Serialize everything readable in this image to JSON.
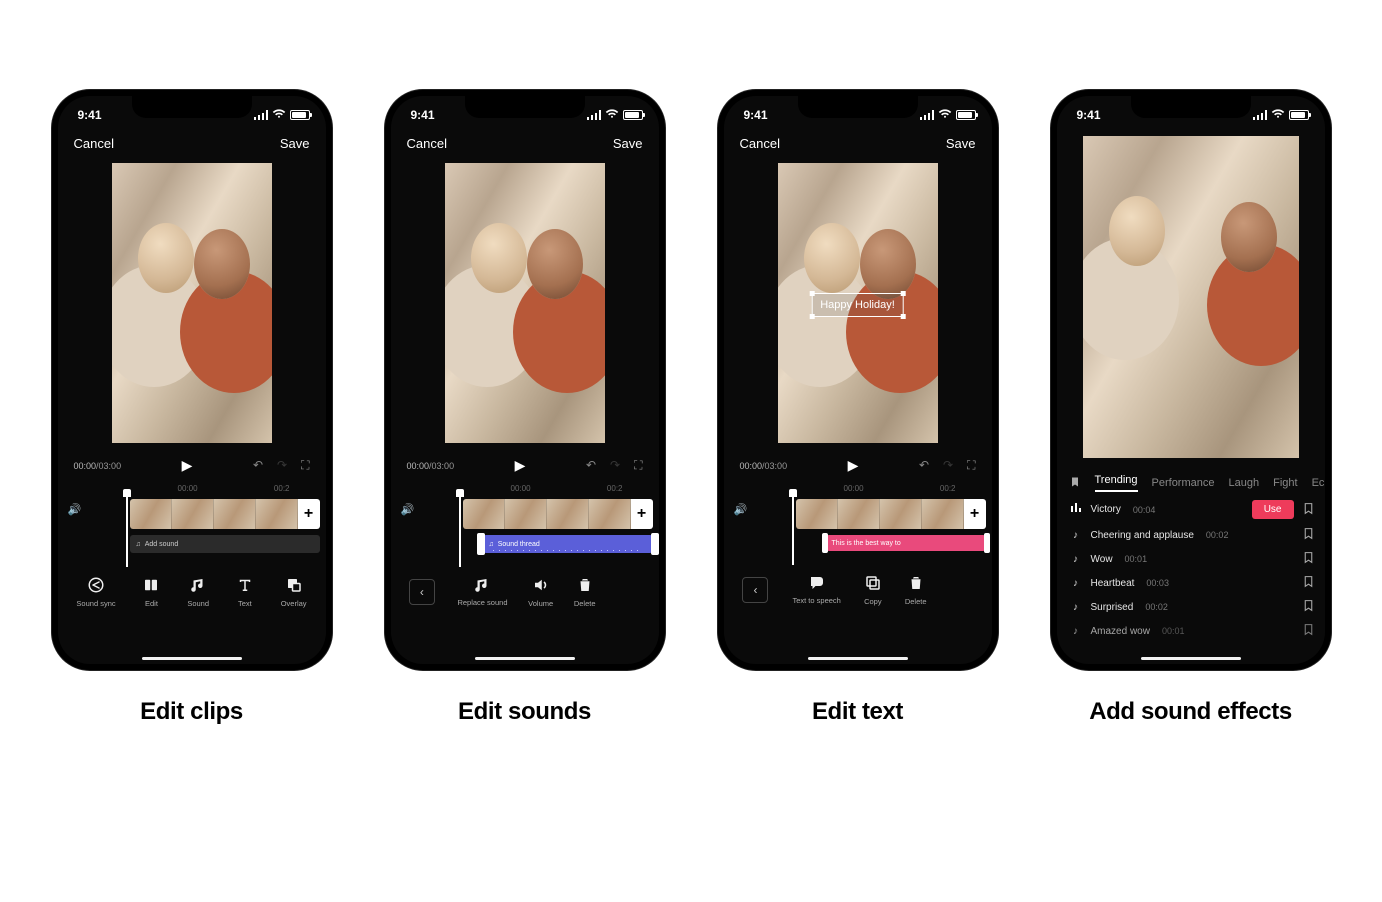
{
  "status": {
    "time": "9:41"
  },
  "topbar": {
    "cancel": "Cancel",
    "save": "Save"
  },
  "time": {
    "current": "00:00",
    "total": "03:00"
  },
  "ruler": {
    "t1": "00:00",
    "t2": "00:2"
  },
  "add_plus": "+",
  "phones": [
    {
      "caption": "Edit clips",
      "sound_track": {
        "label": "Add sound"
      },
      "tools": [
        {
          "label": "Sound sync"
        },
        {
          "label": "Edit"
        },
        {
          "label": "Sound"
        },
        {
          "label": "Text"
        },
        {
          "label": "Overlay"
        }
      ]
    },
    {
      "caption": "Edit sounds",
      "sound_track": {
        "label": "Sound thread"
      },
      "tools": [
        {
          "label": "Replace sound"
        },
        {
          "label": "Volume"
        },
        {
          "label": "Delete"
        }
      ]
    },
    {
      "caption": "Edit text",
      "overlay_text": "Happy Holiday!",
      "sound_track": {
        "label": "This is the best way to"
      },
      "tools": [
        {
          "label": "Text to speech"
        },
        {
          "label": "Copy"
        },
        {
          "label": "Delete"
        }
      ]
    },
    {
      "caption": "Add sound effects",
      "tabs": [
        "Trending",
        "Performance",
        "Laugh",
        "Fight",
        "Ec"
      ],
      "active_tab": 0,
      "use_label": "Use",
      "sounds": [
        {
          "name": "Victory",
          "duration": "00:04",
          "featured": true
        },
        {
          "name": "Cheering and applause",
          "duration": "00:02"
        },
        {
          "name": "Wow",
          "duration": "00:01"
        },
        {
          "name": "Heartbeat",
          "duration": "00:03"
        },
        {
          "name": "Surprised",
          "duration": "00:02"
        },
        {
          "name": "Amazed wow",
          "duration": "00:01"
        }
      ]
    }
  ]
}
